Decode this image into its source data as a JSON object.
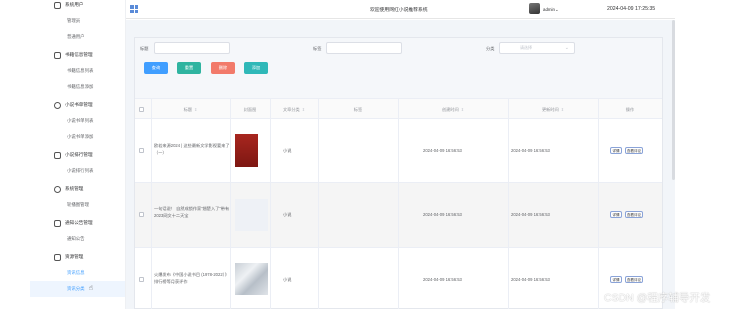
{
  "app": {
    "title": "欢迎使用网红小说推荐系统"
  },
  "header": {
    "user": "admin",
    "datetime": "2024-04-09 17:25:35"
  },
  "sidebar": {
    "groups": [
      {
        "label": "系统用户",
        "icon": "user-icon",
        "items": [
          "管理员",
          "普通用户"
        ]
      },
      {
        "label": "书籍信息管理",
        "icon": "book-icon",
        "items": [
          "书籍信息列表",
          "书籍信息添加"
        ]
      },
      {
        "label": "小说书单管理",
        "icon": "list-icon",
        "items": [
          "小说书单列表",
          "小说书单添加"
        ]
      },
      {
        "label": "小说排行管理",
        "icon": "rank-icon",
        "items": [
          "小说排行列表"
        ]
      },
      {
        "label": "系统管理",
        "icon": "settings-icon",
        "items": [
          "轮播图管理"
        ]
      },
      {
        "label": "通知公告管理",
        "icon": "notice-icon",
        "items": [
          "通知公告"
        ]
      },
      {
        "label": "资源管理",
        "icon": "resource-icon",
        "items": [
          "资讯信息",
          "资讯分类"
        ]
      }
    ]
  },
  "filters": {
    "title_label": "标题",
    "tag_label": "标签",
    "category_label": "分类",
    "category_placeholder": "请选择"
  },
  "buttons": {
    "search": "查询",
    "reset": "重置",
    "delete": "删除",
    "add": "添加"
  },
  "colors": {
    "search": "#409eff",
    "reset": "#2fb4a0",
    "delete": "#f27a6a",
    "add": "#2fb8b8"
  },
  "table": {
    "columns": [
      "标题",
      "封面图",
      "文章分类",
      "标签",
      "创建时间",
      "更新时间",
      "操作"
    ],
    "rows": [
      {
        "title": "欧若来源2024 | 这些最新文学影视要来了（一）",
        "category": "小说",
        "tag": "",
        "created": "2024-04-09 16:56:53",
        "updated": "2024-04-09 16:56:53",
        "actions": [
          "详情",
          "查看评论"
        ]
      },
      {
        "title": "一句话说！ 自然成锁作家“翘楚入了”带有2023网文十二天宝",
        "category": "小说",
        "tag": "",
        "created": "2024-04-09 16:56:53",
        "updated": "2024-04-09 16:56:53",
        "actions": [
          "详情",
          "查看评论"
        ]
      },
      {
        "title": "火爆发布《中国小说书目 (1978-2022）》排行榜等月获评作",
        "category": "小说",
        "tag": "",
        "created": "2024-04-09 16:56:53",
        "updated": "2024-04-09 16:56:53",
        "actions": [
          "详情",
          "查看评论"
        ]
      }
    ]
  },
  "watermark": "CSDN @程序辅导开发"
}
